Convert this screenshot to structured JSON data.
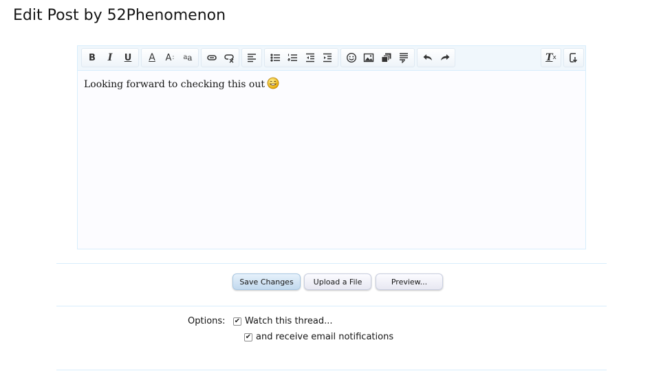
{
  "page": {
    "title": "Edit Post by 52Phenomenon"
  },
  "editor": {
    "content": "Looking forward to checking this out",
    "toolbar": {
      "groups": [
        [
          "bold-icon",
          "italic-icon",
          "underline-icon"
        ],
        [
          "text-color-icon",
          "font-size-icon",
          "font-family-icon"
        ],
        [
          "link-icon",
          "unlink-icon"
        ],
        [
          "align-icon"
        ],
        [
          "bullet-list-icon",
          "numbered-list-icon",
          "outdent-icon",
          "indent-icon"
        ],
        [
          "smilie-icon",
          "image-icon",
          "media-icon",
          "quote-icon"
        ],
        [
          "undo-icon",
          "redo-icon"
        ],
        [
          "remove-formatting-icon"
        ],
        [
          "toggle-bbcode-icon"
        ]
      ],
      "glyphs": {
        "bold": "B",
        "italic": "I",
        "underline": "U",
        "font_family_a": "a",
        "font_family_sub": "a",
        "font_size_a": "A",
        "text_color_a": "A",
        "clear_t": "T",
        "clear_x": "x"
      }
    }
  },
  "buttons": {
    "save": "Save Changes",
    "upload": "Upload a File",
    "preview": "Preview..."
  },
  "options": {
    "label": "Options:",
    "watch_thread": {
      "label": "Watch this thread...",
      "checked": true
    },
    "email_notifications": {
      "label": "and receive email notifications",
      "checked": true
    }
  },
  "colors": {
    "accent_border": "#d7edfc",
    "toolbar_bg": "#f0f7fc",
    "editor_bg": "#fcfcff",
    "primary_button": "#c2d9ee"
  }
}
